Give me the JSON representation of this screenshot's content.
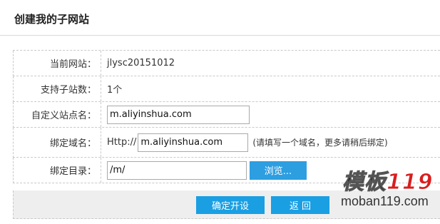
{
  "page": {
    "title": "创建我的子网站"
  },
  "form": {
    "rows": [
      {
        "label": "当前网站：",
        "value": "jlysc20151012"
      },
      {
        "label": "支持子站数：",
        "value": "1个"
      },
      {
        "label": "自定义站点名：",
        "input_value": "m.aliyinshua.com"
      },
      {
        "label": "绑定域名：",
        "prefix": "Http://",
        "input_value": "m.aliyinshua.com",
        "hint": "(请填写一个域名，更多请稍后绑定)"
      },
      {
        "label": "绑定目录：",
        "input_value": "/m/",
        "browse_label": "浏览..."
      }
    ]
  },
  "actions": {
    "confirm_label": "确定开设",
    "back_label": "返 回"
  },
  "watermark": {
    "logo_text": "模板",
    "logo_number": "119",
    "url": "moban119.com"
  },
  "colors": {
    "button_blue": "#1a9fe3",
    "logo_red": "#d81e1e"
  }
}
